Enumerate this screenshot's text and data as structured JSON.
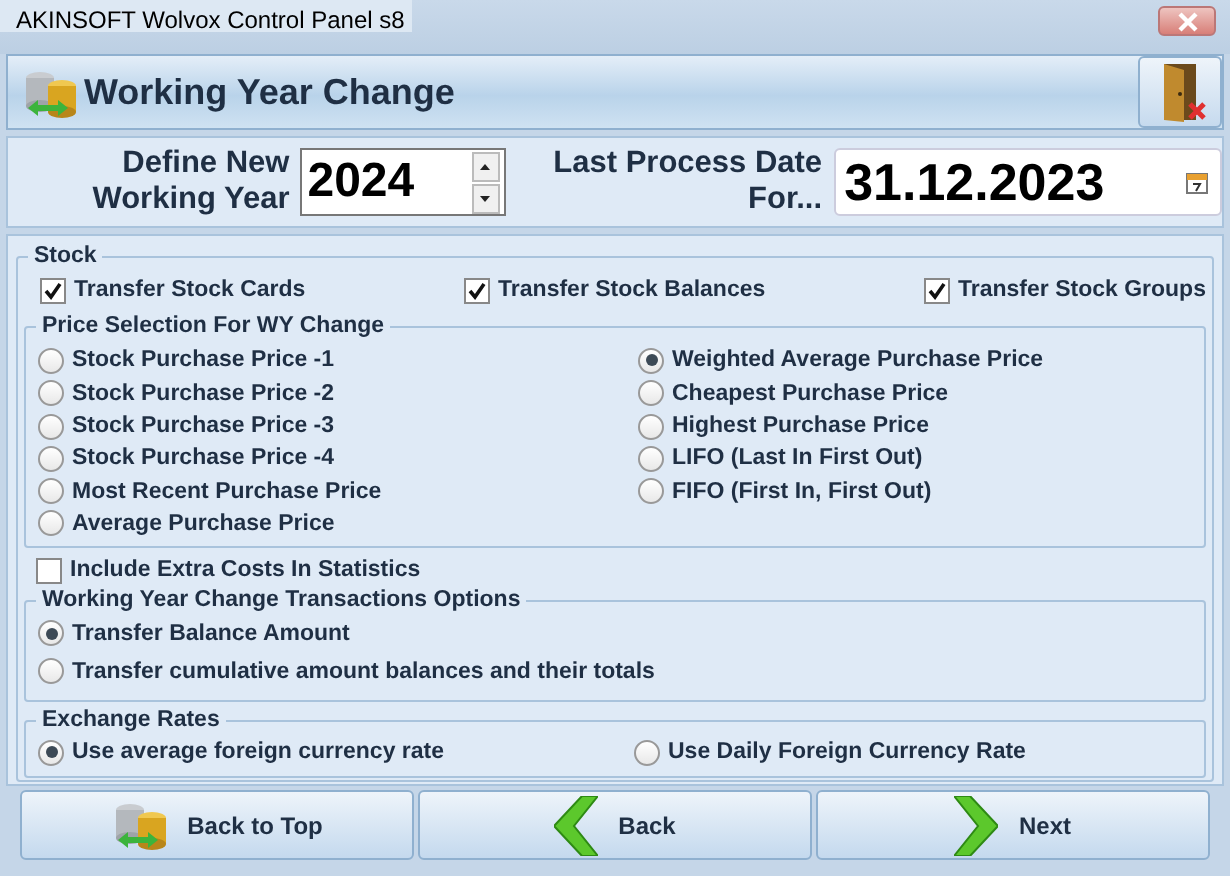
{
  "window": {
    "title": "AKINSOFT Wolvox Control Panel s8"
  },
  "header": {
    "title": "Working Year Change"
  },
  "year_field": {
    "label": "Define New Working Year",
    "value": "2024"
  },
  "date_field": {
    "label": "Last Process Date For...",
    "value": "31.12.2023"
  },
  "stock": {
    "title": "Stock",
    "options": [
      {
        "label": "Transfer Stock Cards",
        "checked": true
      },
      {
        "label": "Transfer Stock Balances",
        "checked": true
      },
      {
        "label": "Transfer Stock Groups",
        "checked": true
      }
    ],
    "price_selection": {
      "title": "Price Selection For WY Change",
      "options": [
        {
          "label": "Stock Purchase Price -1",
          "selected": false
        },
        {
          "label": "Stock Purchase Price -2",
          "selected": false
        },
        {
          "label": "Stock Purchase Price -3",
          "selected": false
        },
        {
          "label": "Stock Purchase Price -4",
          "selected": false
        },
        {
          "label": "Most Recent Purchase Price",
          "selected": false
        },
        {
          "label": "Average Purchase Price",
          "selected": false
        },
        {
          "label": "Weighted Average Purchase Price",
          "selected": true
        },
        {
          "label": "Cheapest Purchase Price",
          "selected": false
        },
        {
          "label": "Highest Purchase Price",
          "selected": false
        },
        {
          "label": "LIFO (Last In First Out)",
          "selected": false
        },
        {
          "label": "FIFO (First In, First Out)",
          "selected": false
        }
      ]
    },
    "extra_costs": {
      "label": "Include Extra Costs In Statistics",
      "checked": false
    },
    "transactions": {
      "title": "Working Year Change Transactions Options",
      "options": [
        {
          "label": "Transfer Balance Amount",
          "selected": true
        },
        {
          "label": "Transfer cumulative amount balances and their totals",
          "selected": false
        }
      ]
    },
    "exchange_rates": {
      "title": "Exchange Rates",
      "options": [
        {
          "label": "Use average foreign currency rate",
          "selected": true
        },
        {
          "label": "Use Daily Foreign Currency Rate",
          "selected": false
        }
      ]
    }
  },
  "buttons": [
    {
      "label": "Back to Top",
      "kind": "home"
    },
    {
      "label": "Back",
      "kind": "back"
    },
    {
      "label": "Next",
      "kind": "next"
    }
  ]
}
